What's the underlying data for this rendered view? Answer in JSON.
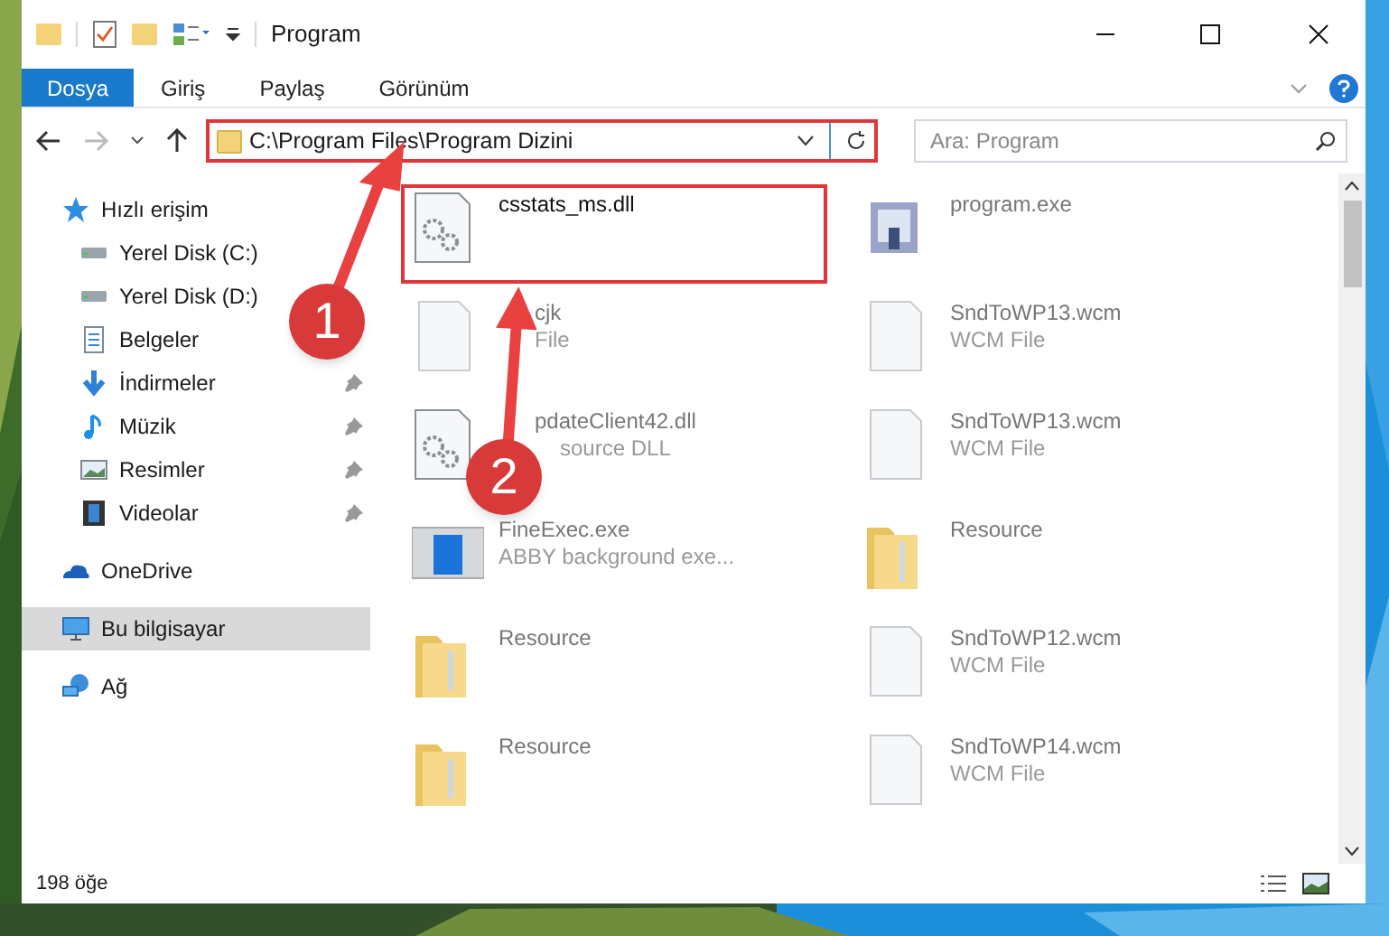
{
  "window": {
    "title": "Program"
  },
  "ribbon_tabs": [
    {
      "label": "Dosya",
      "selected": true
    },
    {
      "label": "Giriş",
      "selected": false
    },
    {
      "label": "Paylaş",
      "selected": false
    },
    {
      "label": "Görünüm",
      "selected": false
    }
  ],
  "address_bar": {
    "path": "C:\\Program Files\\Program Dizini"
  },
  "search": {
    "placeholder": "Ara: Program"
  },
  "sidebar": {
    "items": [
      {
        "label": "Hızlı erişim",
        "kind": "star",
        "selected": false,
        "children": [
          {
            "label": "Yerel Disk (C:)",
            "kind": "disk",
            "pinned": false,
            "selected": false
          },
          {
            "label": "Yerel Disk (D:)",
            "kind": "disk",
            "pinned": false,
            "selected": false
          },
          {
            "label": "Belgeler",
            "kind": "docs",
            "pinned": false,
            "selected": false
          },
          {
            "label": "İndirmeler",
            "kind": "download",
            "pinned": true,
            "selected": false
          },
          {
            "label": "Müzik",
            "kind": "music",
            "pinned": true,
            "selected": false
          },
          {
            "label": "Resimler",
            "kind": "pictures",
            "pinned": true,
            "selected": false
          },
          {
            "label": "Videolar",
            "kind": "video",
            "pinned": true,
            "selected": false
          }
        ]
      },
      {
        "label": "OneDrive",
        "kind": "cloud",
        "selected": false
      },
      {
        "label": "Bu bilgisayar",
        "kind": "pc",
        "selected": true
      },
      {
        "label": "Ağ",
        "kind": "network",
        "selected": false
      }
    ]
  },
  "files": [
    {
      "name": "csstats_ms.dll",
      "kind": "dll",
      "highlighted": true
    },
    {
      "name": "program.exe",
      "kind": "exe",
      "highlighted": false
    },
    {
      "name": "cjk",
      "type": "File",
      "kind": "file",
      "highlighted": false
    },
    {
      "name": "SndToWP13.wcm",
      "type": "WCM File",
      "kind": "file",
      "highlighted": false
    },
    {
      "name": "pdateClient42.dll",
      "type": "source DLL",
      "kind": "dll",
      "highlighted": false
    },
    {
      "name": "SndToWP13.wcm",
      "type": "WCM File",
      "kind": "file",
      "highlighted": false
    },
    {
      "name": "FineExec.exe",
      "type": "ABBY background exe...",
      "kind": "app",
      "highlighted": false
    },
    {
      "name": "Resource",
      "kind": "folder",
      "highlighted": false
    },
    {
      "name": "Resource",
      "kind": "folder",
      "highlighted": false
    },
    {
      "name": "SndToWP12.wcm",
      "type": "WCM File",
      "kind": "file",
      "highlighted": false
    },
    {
      "name": "Resource",
      "kind": "folder",
      "highlighted": false
    },
    {
      "name": "SndToWP14.wcm",
      "type": "WCM File",
      "kind": "file",
      "highlighted": false
    }
  ],
  "status_bar": {
    "item_count": "198 öğe"
  },
  "annotations": [
    {
      "label": "1"
    },
    {
      "label": "2"
    }
  ]
}
